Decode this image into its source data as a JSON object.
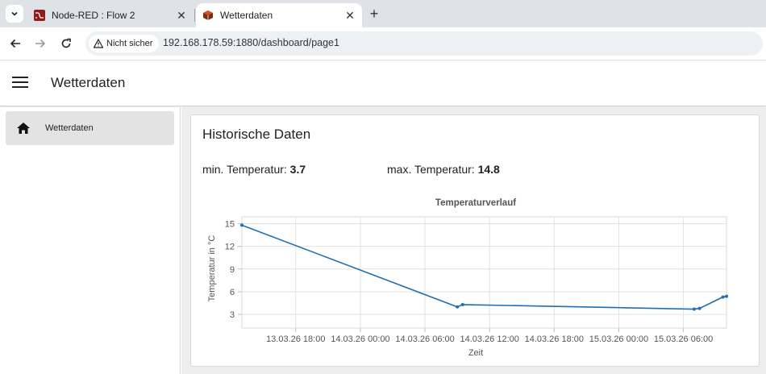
{
  "browser": {
    "tabs": [
      {
        "title": "Node-RED : Flow 2",
        "active": false,
        "favicon": "node-red-icon"
      },
      {
        "title": "Wetterdaten",
        "active": true,
        "favicon": "dashboard-icon"
      }
    ],
    "security_label": "Nicht sicher",
    "url": "192.168.178.59:1880/dashboard/page1"
  },
  "header": {
    "title": "Wetterdaten"
  },
  "sidebar": {
    "items": [
      {
        "label": "Wetterdaten",
        "icon": "home-icon"
      }
    ]
  },
  "card": {
    "title": "Historische Daten",
    "min_label": "min. Temperatur:",
    "min_value": "3.7",
    "max_label": "max. Temperatur:",
    "max_value": "14.8"
  },
  "chart_data": {
    "type": "line",
    "title": "Temperaturverlauf",
    "xlabel": "Zeit",
    "ylabel": "Temperatur in °C",
    "color": "#1f6fb2",
    "yticks": [
      "15",
      "12",
      "9",
      "6",
      "3"
    ],
    "ylim": [
      1.2,
      15.9
    ],
    "xticks": [
      "13.03.26 18:00",
      "14.03.26 00:00",
      "14.03.26 06:00",
      "14.03.26 12:00",
      "14.03.26 18:00",
      "15.03.26 00:00",
      "15.03.26 06:00"
    ],
    "xlim": [
      "2026-03-13 13:00",
      "2026-03-15 10:00"
    ],
    "grid": true,
    "series": [
      {
        "x": [
          "2026-03-13 13:00",
          "2026-03-14 09:00",
          "2026-03-14 09:30",
          "2026-03-15 07:00",
          "2026-03-15 07:30",
          "2026-03-15 09:40",
          "2026-03-15 10:00"
        ],
        "y": [
          14.8,
          4.0,
          4.3,
          3.7,
          3.8,
          5.3,
          5.4
        ]
      }
    ]
  }
}
